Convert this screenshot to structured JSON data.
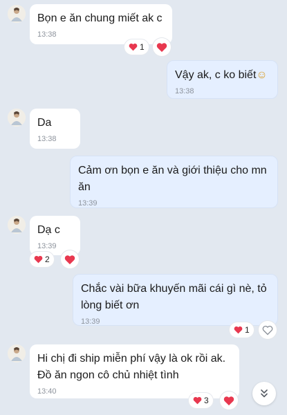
{
  "messages": [
    {
      "direction": "in",
      "text": "Bọn e ăn chung miết ak c",
      "time": "13:38",
      "reaction_count": "1"
    },
    {
      "direction": "out",
      "text": "Vậy ak, c ko biết",
      "emoji": "☺",
      "time": "13:38"
    },
    {
      "direction": "in",
      "text": "Da",
      "time": "13:38"
    },
    {
      "direction": "out",
      "text": "Cảm ơn bọn e ăn và giới thiệu cho mn ăn",
      "time": "13:39"
    },
    {
      "direction": "in",
      "text": "Dạ c",
      "time": "13:39",
      "reaction_count": "2"
    },
    {
      "direction": "out",
      "text": "Chắc vài bữa khuyến mãi cái gì nè, tỏ lòng biết ơn",
      "time": "13:39",
      "reaction_count": "1"
    },
    {
      "direction": "in",
      "text": "Hi chị đi ship miễn phí vậy là ok rồi ak. Đồ ăn ngon cô chủ nhiệt tình",
      "time": "13:40",
      "reaction_count": "3"
    }
  ],
  "icons": {
    "heart": "heart-icon",
    "heart_outline": "heart-outline-icon",
    "scroll": "chevron-double-down-icon",
    "avatar": "avatar"
  },
  "colors": {
    "background": "#e2e8f0",
    "incoming_bubble": "#ffffff",
    "outgoing_bubble": "#e5efff",
    "heart": "#e8384f",
    "timestamp": "#8d939c"
  }
}
